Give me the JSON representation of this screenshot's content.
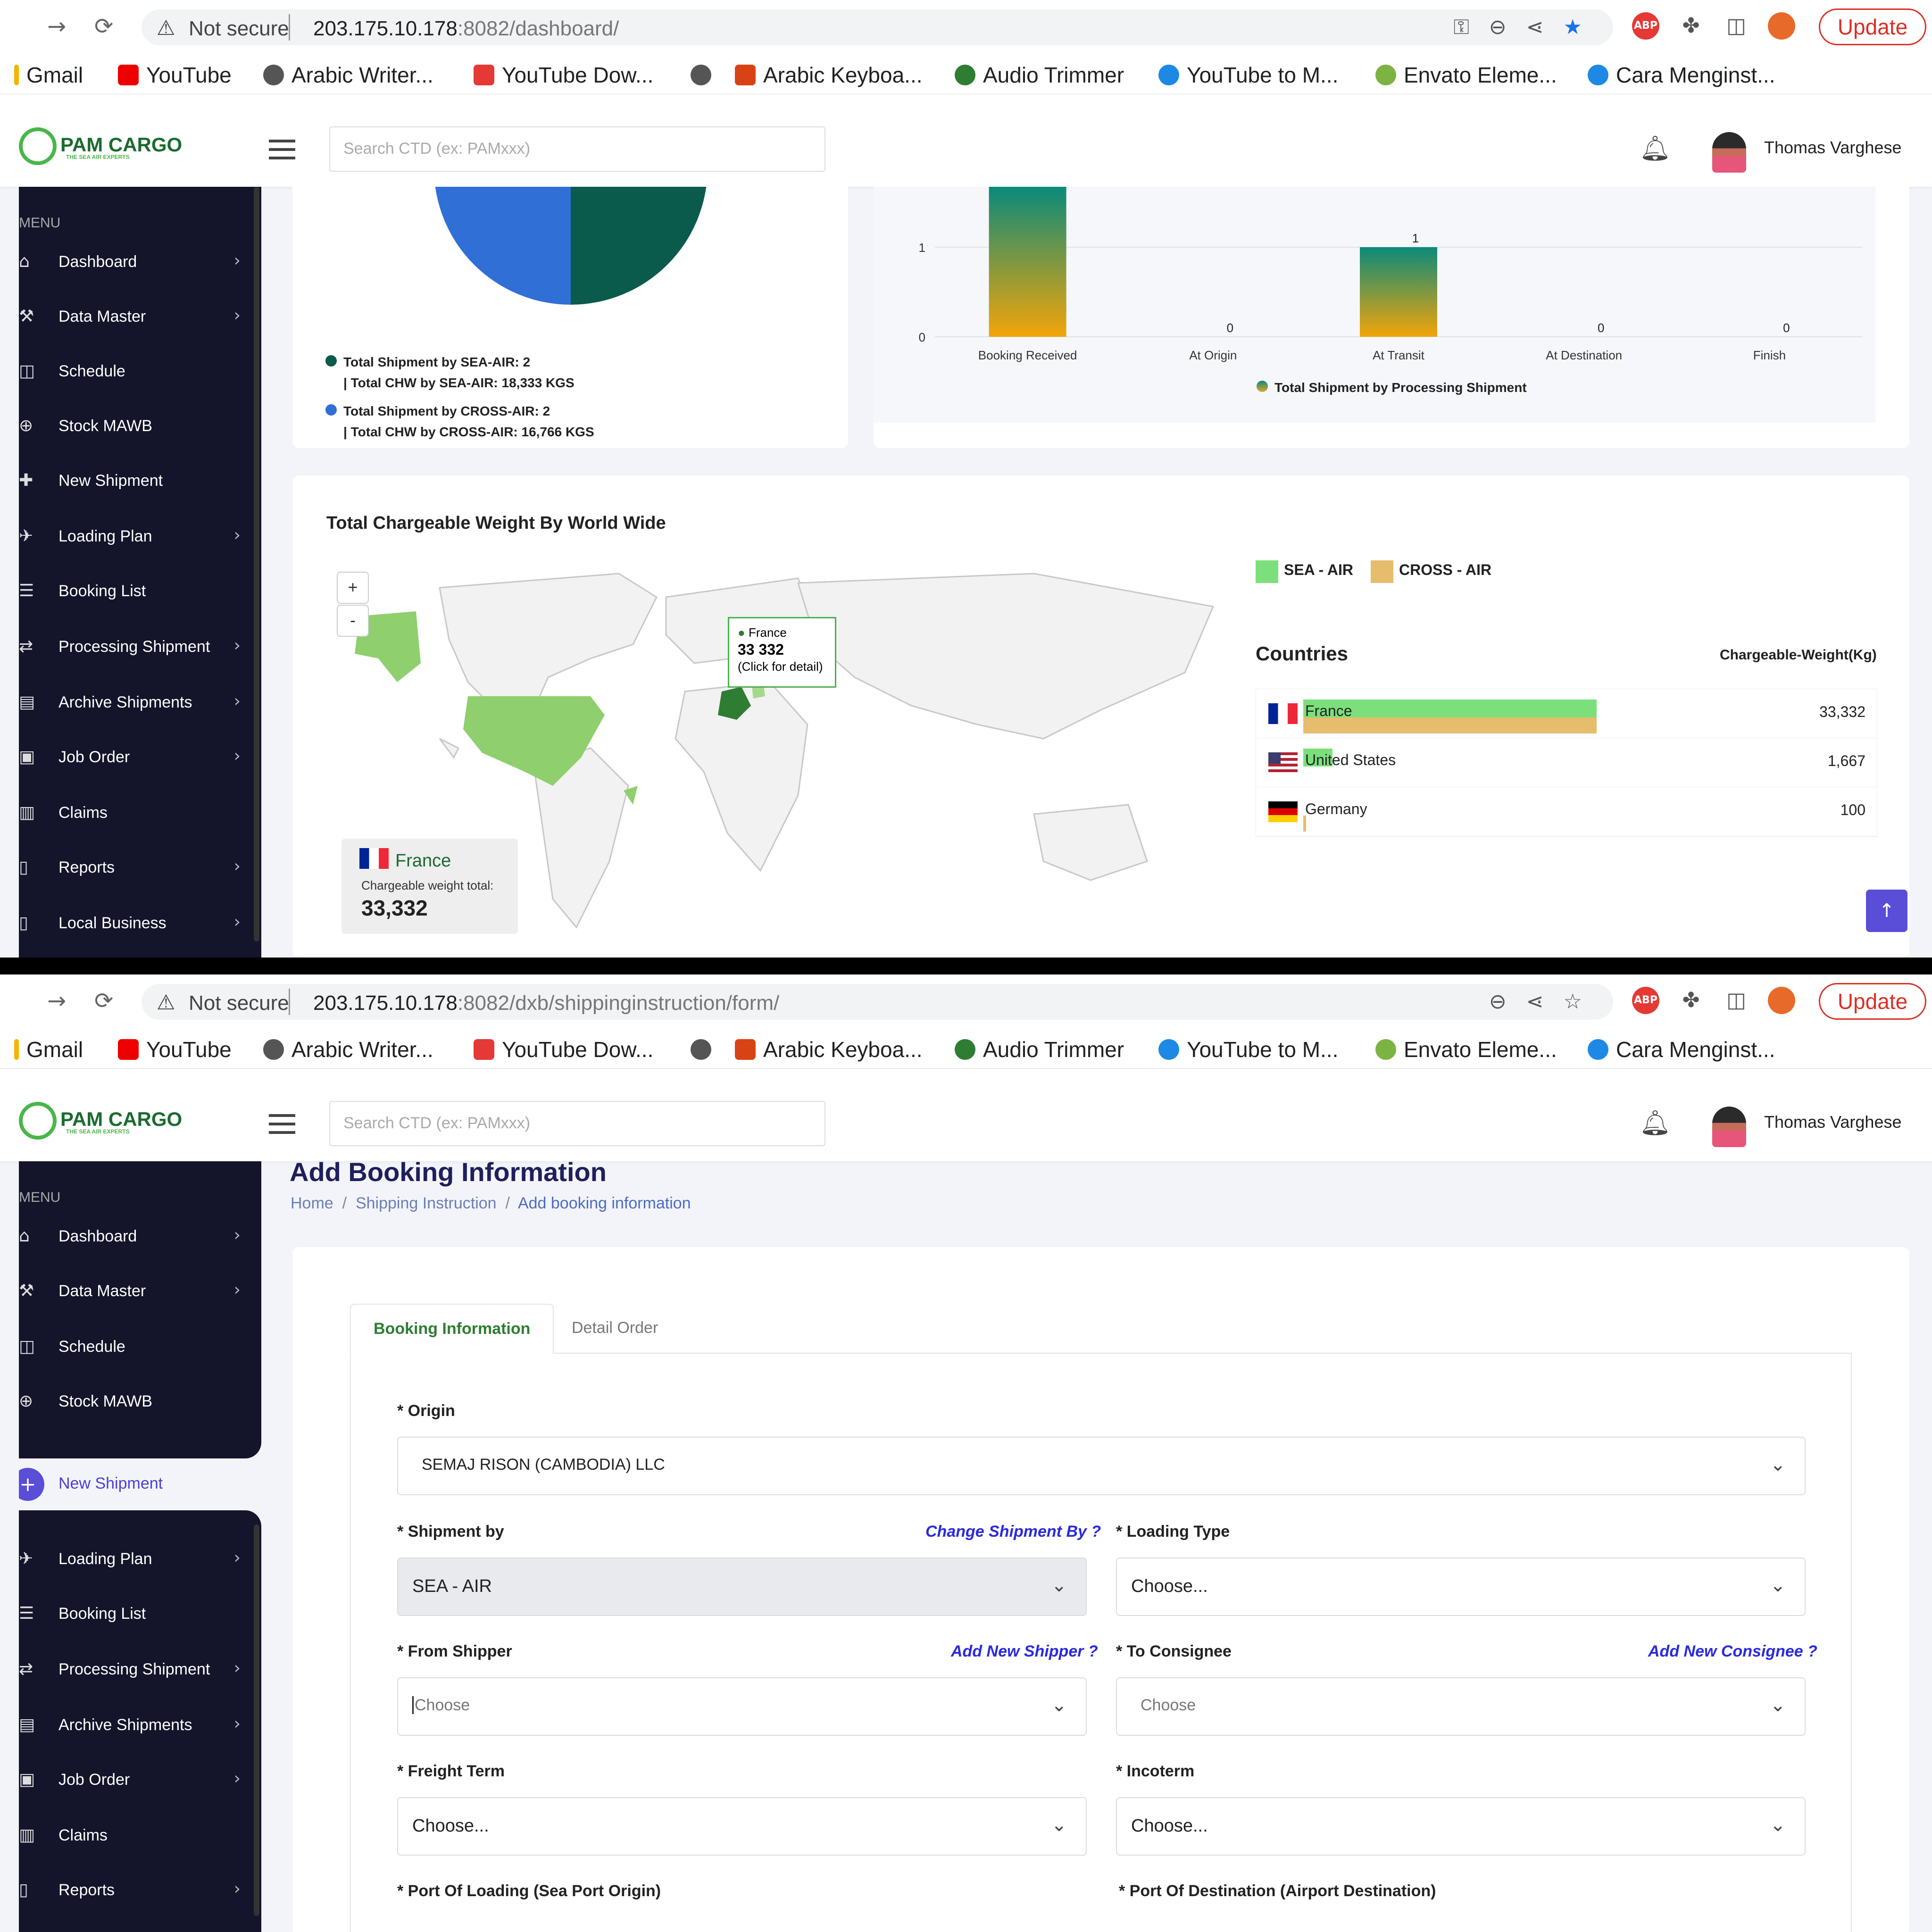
{
  "browser": {
    "not_secure": "Not secure",
    "host": "203.175.10.178",
    "top_path": ":8082/dashboard/",
    "bottom_path": ":8082/dxb/shippinginstruction/form/",
    "update": "Update",
    "bookmarks": [
      "Gmail",
      "YouTube",
      "Arabic Writer...",
      "YouTube Dow...",
      "Arabic Keyboa...",
      "Audio Trimmer",
      "YouTube to M...",
      "Envato Eleme...",
      "Cara Menginst..."
    ]
  },
  "app": {
    "logo": "PAM CARGO",
    "logo_tag": "THE SEA AIR EXPERTS",
    "search_placeholder": "Search CTD (ex: PAMxxx)",
    "user": "Thomas Varghese"
  },
  "sidebar": {
    "heading": "MENU",
    "items": [
      "Dashboard",
      "Data Master",
      "Schedule",
      "Stock MAWB",
      "New Shipment",
      "Loading Plan",
      "Booking List",
      "Processing Shipment",
      "Archive Shipments",
      "Job Order",
      "Claims",
      "Reports",
      "Local Business"
    ]
  },
  "dashboard": {
    "pie_legend": {
      "sea_line1": "Total Shipment by SEA-AIR: 2",
      "sea_line2": "| Total CHW by SEA-AIR: 18,333 KGS",
      "cross_line1": "Total Shipment by CROSS-AIR: 2",
      "cross_line2": "| Total CHW by CROSS-AIR: 16,766 KGS"
    },
    "world": {
      "title": "Total Chargeable Weight By World Wide",
      "legend_sea": "SEA - AIR",
      "legend_cross": "CROSS - AIR",
      "countries_heading": "Countries",
      "weight_heading": "Chargeable-Weight(Kg)",
      "tooltip_name": "France",
      "tooltip_value": "33 332",
      "tooltip_hint": "(Click for detail)",
      "zoom_in": "+",
      "zoom_out": "-",
      "card_country": "France",
      "card_label": "Chargeable weight total:",
      "card_value": "33,332",
      "rows": [
        {
          "country": "France",
          "weight": "33,332",
          "sea_frac": 1.0,
          "cross_frac": 1.0
        },
        {
          "country": "United States",
          "weight": "1,667",
          "sea_frac": 0.1,
          "cross_frac": 0
        },
        {
          "country": "Germany",
          "weight": "100",
          "sea_frac": 0,
          "cross_frac": 0.01
        }
      ]
    }
  },
  "chart_data": {
    "type": "bar",
    "categories": [
      "Booking Received",
      "At Origin",
      "At Transit",
      "At Destination",
      "Finish"
    ],
    "values": [
      2,
      0,
      1,
      0,
      0
    ],
    "data_labels": [
      "",
      "0",
      "1",
      "0",
      "0"
    ],
    "y_ticks": [
      "0",
      "1"
    ],
    "legend": "Total Shipment by Processing Shipment",
    "ylim": [
      0,
      2
    ]
  },
  "form": {
    "page_title": "Add Booking Information",
    "breadcrumb": [
      "Home",
      "Shipping Instruction",
      "Add booking information"
    ],
    "tab_booking": "Booking Information",
    "tab_detail": "Detail Order",
    "origin_label": "* Origin",
    "origin_value": "SEMAJ RISON (CAMBODIA) LLC",
    "shipment_by_label": "* Shipment by",
    "shipment_by_link": "Change Shipment By ?",
    "shipment_by_value": "SEA - AIR",
    "loading_type_label": "* Loading Type",
    "loading_type_value": "Choose...",
    "from_shipper_label": "* From Shipper",
    "from_shipper_link": "Add New Shipper ?",
    "from_shipper_value": "Choose",
    "to_consignee_label": "* To Consignee",
    "to_consignee_link": "Add New Consignee ?",
    "to_consignee_value": "Choose",
    "freight_term_label": "* Freight Term",
    "freight_term_value": "Choose...",
    "incoterm_label": "* Incoterm",
    "incoterm_value": "Choose...",
    "pol_label": "* Port Of Loading (Sea Port Origin)",
    "pod_label": "* Port Of Destination (Airport Destination)"
  }
}
